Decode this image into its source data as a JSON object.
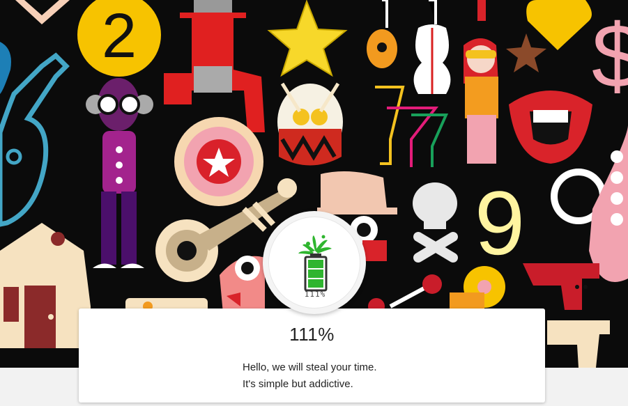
{
  "background": {
    "description_icons": [
      "guitar-icon",
      "number-two-icon",
      "star-icon",
      "violin-icon",
      "lipstick-icon",
      "heart-icon",
      "dollar-icon",
      "robot-head-icon",
      "drum-icon",
      "cocktail-glasses-icon",
      "singer-icon",
      "lips-icon",
      "target-icon",
      "trumpet-icon",
      "skull-icon",
      "number-nine-icon",
      "saxophone-icon",
      "house-icon",
      "gun-icon",
      "record-icon"
    ],
    "number_two": "2",
    "number_nine": "9"
  },
  "badge": {
    "icon": "battery-splash-icon",
    "battery_label": "111%"
  },
  "card": {
    "percent": "111%",
    "line1": "Hello, we will steal your time.",
    "line2": "It's simple but addictive."
  },
  "colors": {
    "accent_green": "#2fb52f",
    "background_dark": "#0b0b0b",
    "card": "#ffffff"
  }
}
